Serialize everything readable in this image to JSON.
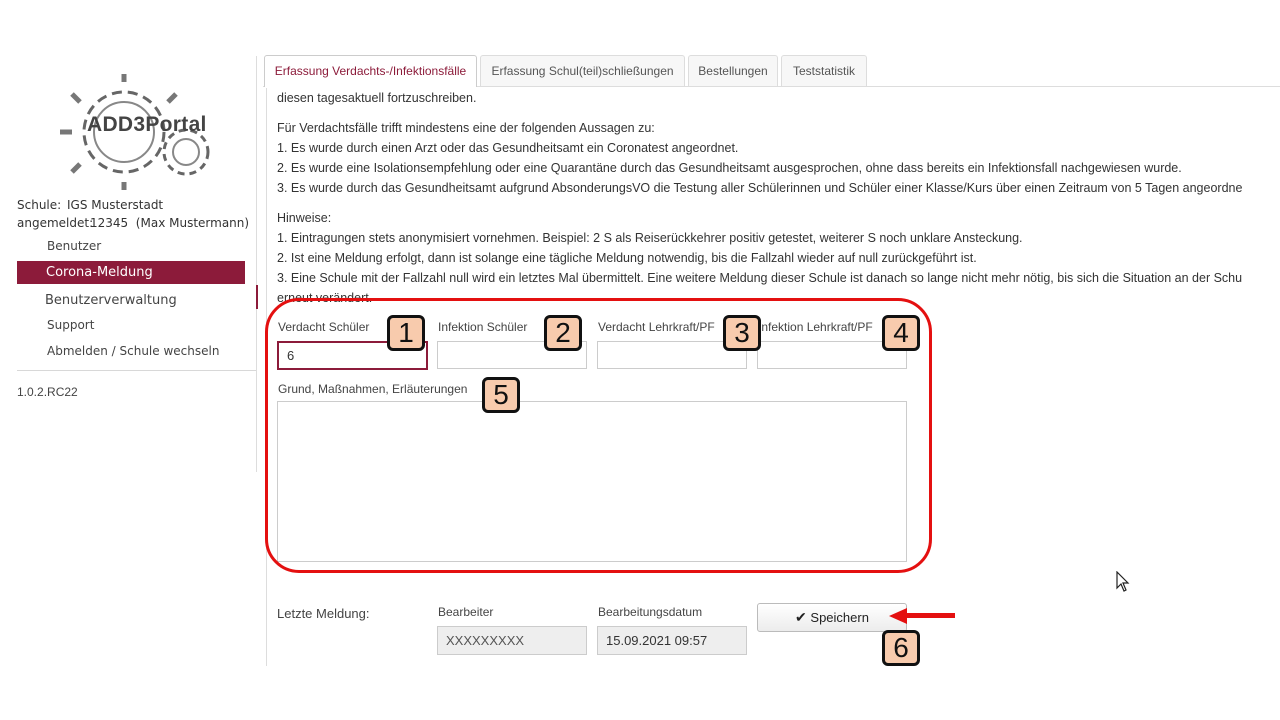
{
  "sidebar": {
    "logo_text": "ADD3Portal",
    "school_label": "Schule:",
    "school_value": "IGS Musterstadt",
    "logged_in_label": "angemeldet:",
    "logged_in_value": "12345  (Max Mustermann)",
    "nav": {
      "benutzer": "Benutzer",
      "corona": "Corona-Meldung",
      "benutzerverwaltung": "Benutzerverwaltung",
      "support": "Support",
      "abmelden": "Abmelden / Schule wechseln"
    },
    "version": "1.0.2.RC22"
  },
  "tabs": [
    {
      "label": "Erfassung Verdachts-/Infektionsfälle",
      "active": true
    },
    {
      "label": "Erfassung Schul(teil)schließungen",
      "active": false
    },
    {
      "label": "Bestellungen",
      "active": false
    },
    {
      "label": "Teststatistik",
      "active": false
    }
  ],
  "content": {
    "line0": "diesen tagesaktuell fortzuschreiben.",
    "intro": "Für Verdachtsfälle trifft mindestens eine der folgenden Aussagen zu:",
    "p1": "1. Es wurde durch einen Arzt oder das Gesundheitsamt ein Coronatest angeordnet.",
    "p2": "2. Es wurde eine Isolationsempfehlung oder eine Quarantäne durch das Gesundheitsamt ausgesprochen, ohne dass bereits ein Infektionsfall nachgewiesen wurde.",
    "p3": "3. Es wurde durch das Gesundheitsamt aufgrund AbsonderungsVO die Testung aller Schülerinnen und Schüler einer Klasse/Kurs über einen Zeitraum von 5 Tagen angeordne",
    "hinweise": "Hinweise:",
    "h1": "1. Eintragungen stets anonymisiert vornehmen. Beispiel: 2 S als Reiserückkehrer positiv getestet, weiterer S noch unklare Ansteckung.",
    "h2": "2. Ist eine Meldung erfolgt, dann ist solange eine tägliche Meldung notwendig, bis die Fallzahl wieder auf null zurückgeführt ist.",
    "h3": "3. Eine Schule mit der Fallzahl null wird ein letztes Mal übermittelt. Eine weitere Meldung dieser Schule ist danach so lange nicht mehr nötig, bis sich die Situation an der Schu",
    "h3b": "erneut verändert."
  },
  "form": {
    "verdacht_schueler_label": "Verdacht Schüler",
    "verdacht_schueler_value": "6",
    "infektion_schueler_label": "Infektion Schüler",
    "infektion_schueler_value": "",
    "verdacht_lehrkraft_label": "Verdacht Lehrkraft/PF",
    "verdacht_lehrkraft_value": "",
    "infektion_lehrkraft_label": "Infektion Lehrkraft/PF",
    "infektion_lehrkraft_value": "",
    "grund_label": "Grund, Maßnahmen, Erläuterungen",
    "grund_value": ""
  },
  "footer": {
    "letzte_meldung": "Letzte Meldung:",
    "bearbeiter_label": "Bearbeiter",
    "bearbeiter_value": "XXXXXXXXX",
    "datum_label": "Bearbeitungsdatum",
    "datum_value": "15.09.2021 09:57",
    "save_label": "Speichern",
    "save_icon": "check-icon"
  },
  "callouts": [
    "1",
    "2",
    "3",
    "4",
    "5",
    "6"
  ],
  "colors": {
    "accent": "#8c1b3a",
    "callout": "#e41010",
    "badge": "#f8cbad"
  }
}
